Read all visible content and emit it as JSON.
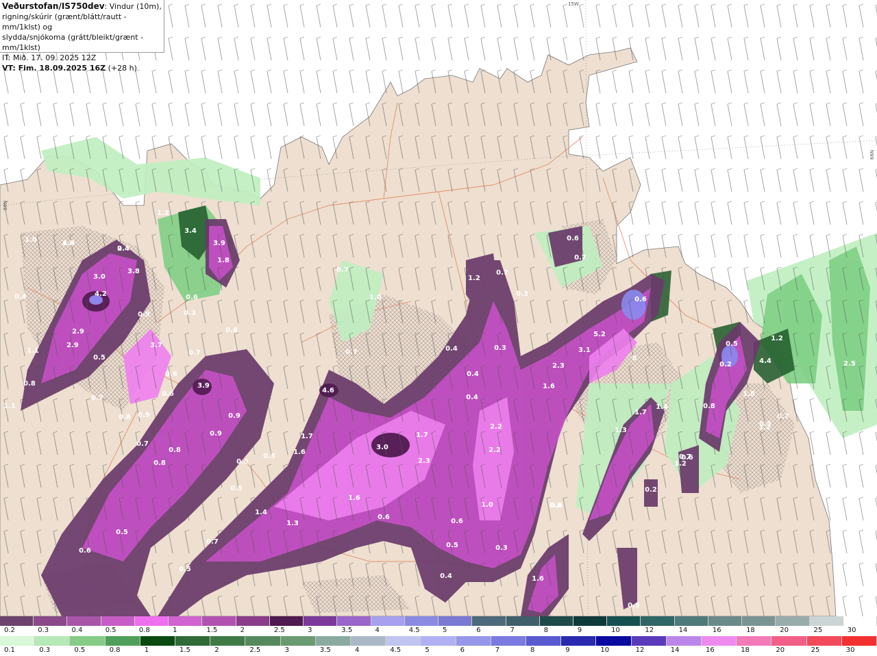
{
  "header": {
    "title": "Veðurstofan/IS750dev",
    "desc1": ": Vindur (10m),",
    "desc2": "rigning/skúrir (grænt/blátt/rautt - mm/1klst) og",
    "desc3": "slydda/snjókoma (grátt/bleikt/grænt - mm/1klst)",
    "it": "IT: Mið. 17. 09. 2025 12Z",
    "vt": "VT: Fim. 18.09.2025 16Z",
    "vt_suffix": " (+28 h)"
  },
  "grid_labels": {
    "lon": "15W",
    "lat_left": "66N",
    "lat_right": "66N"
  },
  "colors": {
    "land": "#eedfd0",
    "sea": "#ffffff",
    "road": "#e0805a",
    "precip_light_green": "#bfeec0",
    "precip_green": "#6fbf75",
    "precip_dark_green": "#1f5a2a",
    "precip_dark_purple": "#6a3a6b",
    "precip_purple": "#c650c6",
    "precip_light_purple": "#ee80ee",
    "precip_blue": "#8a8aee"
  },
  "map_values": [
    {
      "label": "4.9"
    },
    {
      "label": "2.4"
    },
    {
      "label": "3.0"
    },
    {
      "label": "3.8"
    },
    {
      "label": "4.2"
    },
    {
      "label": "2.9"
    },
    {
      "label": "2.9"
    },
    {
      "label": "3.7"
    },
    {
      "label": "0.9"
    },
    {
      "label": "1.0"
    },
    {
      "label": "0.5"
    },
    {
      "label": "1.1"
    },
    {
      "label": "0.4"
    },
    {
      "label": "0.8"
    },
    {
      "label": "0.7"
    },
    {
      "label": "0.6"
    },
    {
      "label": "0.6"
    },
    {
      "label": "0.8"
    },
    {
      "label": "0.9"
    },
    {
      "label": "1.1"
    },
    {
      "label": "0.7"
    },
    {
      "label": "0.8"
    },
    {
      "label": "0.8"
    },
    {
      "label": "3.9"
    },
    {
      "label": "0.7"
    },
    {
      "label": "0.9"
    },
    {
      "label": "0.9"
    },
    {
      "label": "3.4"
    },
    {
      "label": "3.9"
    },
    {
      "label": "1.8"
    },
    {
      "label": "1.2"
    },
    {
      "label": "0.6"
    },
    {
      "label": "0.3"
    },
    {
      "label": "0.6"
    },
    {
      "label": "0.3"
    },
    {
      "label": "0.5"
    },
    {
      "label": "0.5"
    },
    {
      "label": "1.4"
    },
    {
      "label": "1.3"
    },
    {
      "label": "0.7"
    },
    {
      "label": "0.5"
    },
    {
      "label": "0.5"
    },
    {
      "label": "0.6"
    },
    {
      "label": "4.6"
    },
    {
      "label": "1.7"
    },
    {
      "label": "1.6"
    },
    {
      "label": "3.0"
    },
    {
      "label": "1.7"
    },
    {
      "label": "2.3"
    },
    {
      "label": "1.6"
    },
    {
      "label": "0.6"
    },
    {
      "label": "1.0"
    },
    {
      "label": "0.7"
    },
    {
      "label": "0.7"
    },
    {
      "label": "1.2"
    },
    {
      "label": "0.7"
    },
    {
      "label": "0.3"
    },
    {
      "label": "0.4"
    },
    {
      "label": "0.4"
    },
    {
      "label": "0.4"
    },
    {
      "label": "0.3"
    },
    {
      "label": "2.2"
    },
    {
      "label": "2.2"
    },
    {
      "label": "1.0"
    },
    {
      "label": "0.6"
    },
    {
      "label": "0.5"
    },
    {
      "label": "0.4"
    },
    {
      "label": "0.3"
    },
    {
      "label": "0.6"
    },
    {
      "label": "1.6"
    },
    {
      "label": "0.6"
    },
    {
      "label": "0.7"
    },
    {
      "label": "0.6"
    },
    {
      "label": "5.2"
    },
    {
      "label": "3.1"
    },
    {
      "label": "2.3"
    },
    {
      "label": "1.6"
    },
    {
      "label": "1.7"
    },
    {
      "label": "1.3"
    },
    {
      "label": "1.4"
    },
    {
      "label": "8"
    },
    {
      "label": "0.5"
    },
    {
      "label": "0.2"
    },
    {
      "label": "4.4"
    },
    {
      "label": "1.2"
    },
    {
      "label": "2.5"
    },
    {
      "label": "0.8"
    },
    {
      "label": "1.8"
    },
    {
      "label": "0.5"
    },
    {
      "label": "0.7"
    },
    {
      "label": "0.6"
    },
    {
      "label": "1.2"
    },
    {
      "label": "0.5"
    },
    {
      "label": "0.2"
    },
    {
      "label": "0.8"
    },
    {
      "label": "0.7"
    },
    {
      "label": "1.2"
    },
    {
      "label": "1.0"
    },
    {
      "label": "0.4"
    }
  ],
  "scale_rain": {
    "labels": [
      "0.2",
      "0.3",
      "0.4",
      "0.5",
      "0.8",
      "1",
      "1.5",
      "2",
      "2.5",
      "3",
      "3.5",
      "4",
      "4.5",
      "5",
      "6",
      "7",
      "8",
      "9",
      "10",
      "12",
      "14",
      "16",
      "18",
      "20",
      "25",
      "30"
    ],
    "colors": [
      "#6b436b",
      "#8a4a8a",
      "#a855a8",
      "#c75cc7",
      "#ee6fee",
      "#d063d0",
      "#b152b1",
      "#8a3c8a",
      "#4f1a4f",
      "#7a3a9a",
      "#9a66c9",
      "#a6a0ee",
      "#8a8ae2",
      "#7a7ad2",
      "#4d6a7a",
      "#3f5f6a",
      "#1f4a4a",
      "#0f3a3a",
      "#175050",
      "#2f6666",
      "#4f7a7a",
      "#6a8a8a",
      "#7a9494",
      "#99acac",
      "#ccd5d5",
      "#ffffff"
    ]
  },
  "scale_snow": {
    "labels": [
      "0.1",
      "0.3",
      "0.5",
      "0.8",
      "1",
      "1.5",
      "2",
      "2.5",
      "3",
      "3.5",
      "4",
      "4.5",
      "5",
      "6",
      "7",
      "8",
      "9",
      "10",
      "12",
      "14",
      "16",
      "18",
      "20",
      "25",
      "30"
    ],
    "colors": [
      "#d8f8d8",
      "#b7e8b7",
      "#86cc86",
      "#4f9f5a",
      "#0a4a10",
      "#2f6a37",
      "#3f7a47",
      "#568a5e",
      "#6a9a72",
      "#8aaaa0",
      "#aab8c6",
      "#c0c4ee",
      "#b0b0f2",
      "#9696ea",
      "#7a7ae0",
      "#5a5ad0",
      "#2a2ab0",
      "#0a0aa0",
      "#5a3aba",
      "#ba86ea",
      "#ee8aee",
      "#f27ab8",
      "#f2608a",
      "#f24a5a",
      "#f23030"
    ]
  }
}
